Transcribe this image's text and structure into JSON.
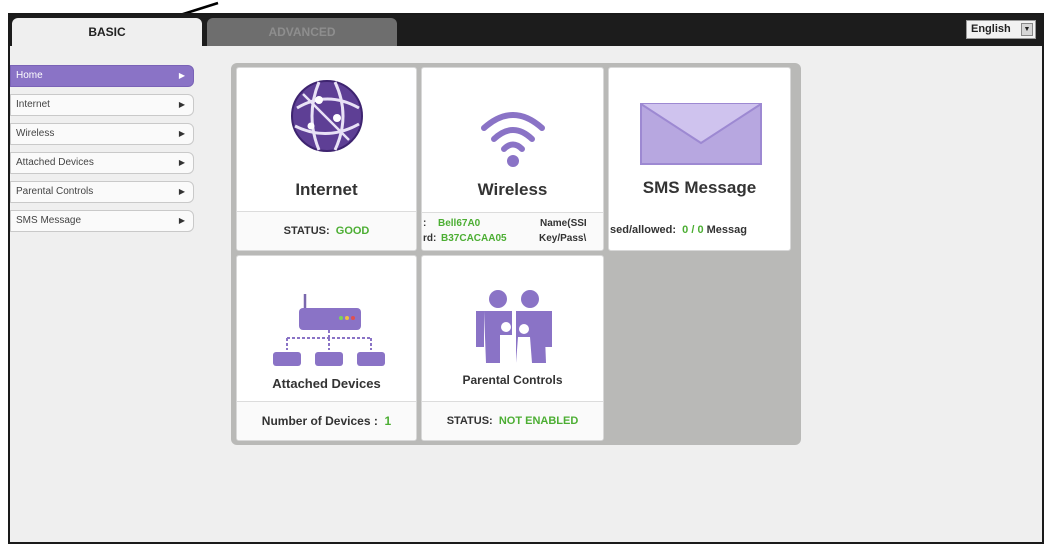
{
  "tabs": {
    "basic": "BASIC",
    "advanced": "ADVANCED"
  },
  "language": {
    "selected": "English"
  },
  "sidebar": {
    "items": [
      {
        "label": "Home"
      },
      {
        "label": "Internet"
      },
      {
        "label": "Wireless"
      },
      {
        "label": "Attached Devices"
      },
      {
        "label": "Parental Controls"
      },
      {
        "label": "SMS Message"
      }
    ]
  },
  "cards": {
    "internet": {
      "title": "Internet",
      "status_label": "STATUS:",
      "status_value": "GOOD"
    },
    "wireless": {
      "title": "Wireless",
      "line1_prefix": ":",
      "line1_value": "Bell67A0",
      "line1_suffix": "Name(SSI",
      "line2_prefix": "rd:",
      "line2_value": "B37CACAA05",
      "line2_suffix": "Key/Pass\\"
    },
    "sms": {
      "title": "SMS Message",
      "foot_prefix": "sed/allowed:",
      "foot_value": "0 / 0",
      "foot_suffix": "Messag"
    },
    "attached": {
      "title": "Attached Devices",
      "foot_label": "Number of Devices :",
      "foot_value": "1"
    },
    "parental": {
      "title": "Parental Controls",
      "status_label": "STATUS:",
      "status_value": "NOT ENABLED"
    }
  },
  "colors": {
    "accent": "#8a73c6",
    "status_green": "#4cae33",
    "panel": "#b9b9b7"
  }
}
